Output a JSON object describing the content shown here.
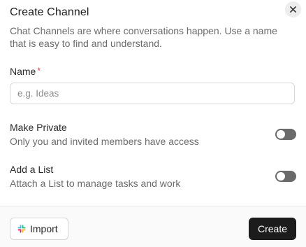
{
  "dialog": {
    "title": "Create Channel",
    "subtitle": "Chat Channels are where conversations happen. Use a name that is easy to find and understand.",
    "close_icon": "close-icon"
  },
  "name_field": {
    "label": "Name",
    "required_mark": "*",
    "placeholder": "e.g. Ideas",
    "value": ""
  },
  "options": {
    "private": {
      "title": "Make Private",
      "description": "Only you and invited members have access",
      "enabled": false
    },
    "list": {
      "title": "Add a List",
      "description": "Attach a List to manage tasks and work",
      "enabled": false
    }
  },
  "footer": {
    "import_label": "Import",
    "import_icon": "slack-icon",
    "create_label": "Create"
  },
  "colors": {
    "required": "#d0384a",
    "toggle_off": "#6a6a6a",
    "primary_button": "#1c1c1c"
  }
}
